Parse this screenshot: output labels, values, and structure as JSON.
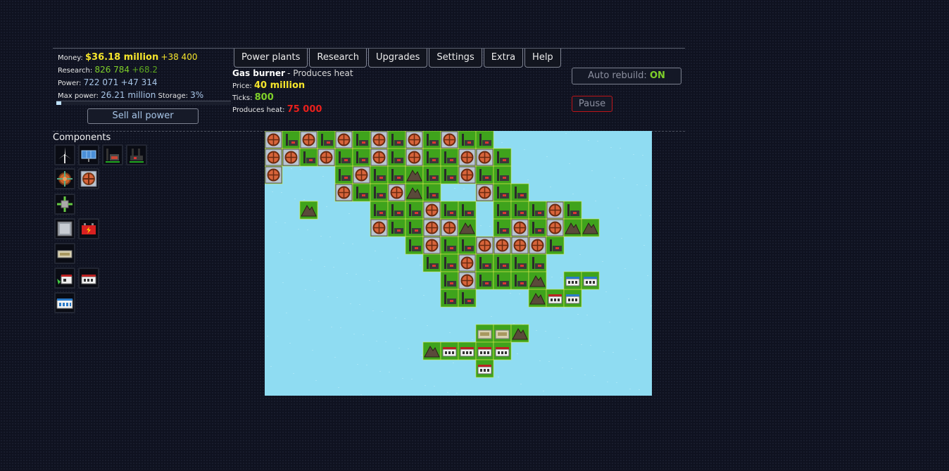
{
  "stats": {
    "money_label": "Money:",
    "money_value": "$36.18 million",
    "money_income": "+38 400",
    "research_label": "Research:",
    "research_value": "826 784",
    "research_income": "+68.2",
    "power_label": "Power:",
    "power_value": "722 071",
    "power_income": "+47 314",
    "maxpower_label": "Max power:",
    "maxpower_value": "26.21 million",
    "storage_label": "Storage:",
    "storage_value": "3%",
    "storage_fraction": 0.03,
    "sell_label": "Sell all power"
  },
  "tabs": [
    "Power plants",
    "Research",
    "Upgrades",
    "Settings",
    "Extra",
    "Help"
  ],
  "info": {
    "title": "Gas burner",
    "description": "- Produces heat",
    "price_label": "Price:",
    "price_value": "40 million",
    "ticks_label": "Ticks:",
    "ticks_value": "800",
    "heat_label": "Produces heat:",
    "heat_value": "75 000"
  },
  "controls": {
    "auto_rebuild_label": "Auto rebuild:",
    "auto_rebuild_state": "ON",
    "pause_label": "Pause"
  },
  "components": {
    "title": "Components",
    "items": [
      {
        "icon": "wind-turbine-icon"
      },
      {
        "icon": "solar-panel-icon"
      },
      {
        "icon": "coal-burner-icon"
      },
      {
        "icon": "gas-burner-icon"
      },
      {
        "icon": "heat-exchanger-icon"
      },
      {
        "icon": "heat-inlet-icon"
      },
      {
        "icon": "heat-outlet-icon"
      },
      {
        "icon": "water-pump-icon"
      },
      {
        "icon": "battery-icon"
      },
      {
        "icon": "generator-icon"
      },
      {
        "icon": "lab-icon"
      },
      {
        "icon": "office-icon"
      },
      {
        "icon": "bank-icon"
      }
    ]
  },
  "colors": {
    "money": "#f5e52c",
    "research": "#7fd02a",
    "power": "#a8c6e8",
    "heat": "#e8201c",
    "water": "#8fdcf2",
    "land": "#3fa31c"
  }
}
